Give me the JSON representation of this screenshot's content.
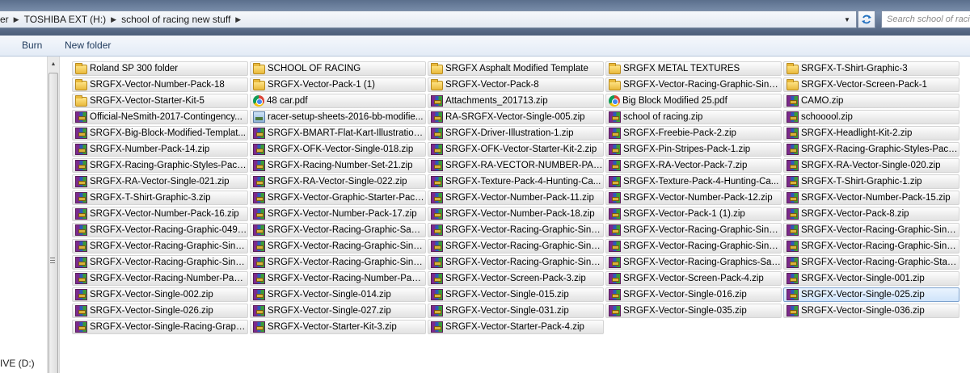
{
  "address_bar": {
    "breadcrumbs": [
      "er",
      "TOSHIBA EXT (H:)",
      "school of racing new stuff"
    ],
    "search_placeholder": "Search school of racing"
  },
  "toolbar": {
    "burn_label": "Burn",
    "new_folder_label": "New folder"
  },
  "navigation_pane": {
    "drive_label": "IVE (D:)"
  },
  "files": [
    {
      "name": "Roland SP 300 folder",
      "icon": "folder-icon"
    },
    {
      "name": "SCHOOL OF RACING",
      "icon": "folder-icon"
    },
    {
      "name": "SRGFX Asphalt Modified Template",
      "icon": "folder-icon"
    },
    {
      "name": "SRGFX METAL TEXTURES",
      "icon": "folder-icon"
    },
    {
      "name": "SRGFX-T-Shirt-Graphic-3",
      "icon": "folder-icon"
    },
    {
      "name": "SRGFX-Vector-Number-Pack-18",
      "icon": "folder-icon"
    },
    {
      "name": "SRGFX-Vector-Pack-1 (1)",
      "icon": "folder-icon"
    },
    {
      "name": "SRGFX-Vector-Pack-8",
      "icon": "folder-icon"
    },
    {
      "name": "SRGFX-Vector-Racing-Graphic-Singl...",
      "icon": "folder-icon"
    },
    {
      "name": "SRGFX-Vector-Screen-Pack-1",
      "icon": "folder-icon"
    },
    {
      "name": "SRGFX-Vector-Starter-Kit-5",
      "icon": "folder-icon"
    },
    {
      "name": "48 car.pdf",
      "icon": "pdf-icon"
    },
    {
      "name": "Attachments_201713.zip",
      "icon": "zip-icon"
    },
    {
      "name": "Big Block Modified 25.pdf",
      "icon": "pdf-icon"
    },
    {
      "name": "CAMO.zip",
      "icon": "zip-icon"
    },
    {
      "name": "Official-NeSmith-2017-Contingency...",
      "icon": "zip-icon"
    },
    {
      "name": "racer-setup-sheets-2016-bb-modifie...",
      "icon": "image-icon"
    },
    {
      "name": "RA-SRGFX-Vector-Single-005.zip",
      "icon": "zip-icon"
    },
    {
      "name": "school of racing.zip",
      "icon": "zip-icon"
    },
    {
      "name": "schooool.zip",
      "icon": "zip-icon"
    },
    {
      "name": "SRGFX-Big-Block-Modified-Templat...",
      "icon": "zip-icon"
    },
    {
      "name": "SRGFX-BMART-Flat-Kart-Illustration...",
      "icon": "zip-icon"
    },
    {
      "name": "SRGFX-Driver-Illustration-1.zip",
      "icon": "zip-icon"
    },
    {
      "name": "SRGFX-Freebie-Pack-2.zip",
      "icon": "zip-icon"
    },
    {
      "name": "SRGFX-Headlight-Kit-2.zip",
      "icon": "zip-icon"
    },
    {
      "name": "SRGFX-Number-Pack-14.zip",
      "icon": "zip-icon"
    },
    {
      "name": "SRGFX-OFK-Vector-Single-018.zip",
      "icon": "zip-icon"
    },
    {
      "name": "SRGFX-OFK-Vector-Starter-Kit-2.zip",
      "icon": "zip-icon"
    },
    {
      "name": "SRGFX-Pin-Stripes-Pack-1.zip",
      "icon": "zip-icon"
    },
    {
      "name": "SRGFX-Racing-Graphic-Styles-Pack-...",
      "icon": "zip-icon"
    },
    {
      "name": "SRGFX-Racing-Graphic-Styles-Pack-...",
      "icon": "zip-icon"
    },
    {
      "name": "SRGFX-Racing-Number-Set-21.zip",
      "icon": "zip-icon"
    },
    {
      "name": "SRGFX-RA-VECTOR-NUMBER-PACK...",
      "icon": "zip-icon"
    },
    {
      "name": "SRGFX-RA-Vector-Pack-7.zip",
      "icon": "zip-icon"
    },
    {
      "name": "SRGFX-RA-Vector-Single-020.zip",
      "icon": "zip-icon"
    },
    {
      "name": "SRGFX-RA-Vector-Single-021.zip",
      "icon": "zip-icon"
    },
    {
      "name": "SRGFX-RA-Vector-Single-022.zip",
      "icon": "zip-icon"
    },
    {
      "name": "SRGFX-Texture-Pack-4-Hunting-Ca...",
      "icon": "zip-icon"
    },
    {
      "name": "SRGFX-Texture-Pack-4-Hunting-Ca...",
      "icon": "zip-icon"
    },
    {
      "name": "SRGFX-T-Shirt-Graphic-1.zip",
      "icon": "zip-icon"
    },
    {
      "name": "SRGFX-T-Shirt-Graphic-3.zip",
      "icon": "zip-icon"
    },
    {
      "name": "SRGFX-Vector-Graphic-Starter-Pack-...",
      "icon": "zip-icon"
    },
    {
      "name": "SRGFX-Vector-Number-Pack-11.zip",
      "icon": "zip-icon"
    },
    {
      "name": "SRGFX-Vector-Number-Pack-12.zip",
      "icon": "zip-icon"
    },
    {
      "name": "SRGFX-Vector-Number-Pack-15.zip",
      "icon": "zip-icon"
    },
    {
      "name": "SRGFX-Vector-Number-Pack-16.zip",
      "icon": "zip-icon"
    },
    {
      "name": "SRGFX-Vector-Number-Pack-17.zip",
      "icon": "zip-icon"
    },
    {
      "name": "SRGFX-Vector-Number-Pack-18.zip",
      "icon": "zip-icon"
    },
    {
      "name": "SRGFX-Vector-Pack-1 (1).zip",
      "icon": "zip-icon"
    },
    {
      "name": "SRGFX-Vector-Pack-8.zip",
      "icon": "zip-icon"
    },
    {
      "name": "SRGFX-Vector-Racing-Graphic-049.zip",
      "icon": "zip-icon"
    },
    {
      "name": "SRGFX-Vector-Racing-Graphic-Sam...",
      "icon": "zip-icon"
    },
    {
      "name": "SRGFX-Vector-Racing-Graphic-Singl...",
      "icon": "zip-icon"
    },
    {
      "name": "SRGFX-Vector-Racing-Graphic-Singl...",
      "icon": "zip-icon"
    },
    {
      "name": "SRGFX-Vector-Racing-Graphic-Singl...",
      "icon": "zip-icon"
    },
    {
      "name": "SRGFX-Vector-Racing-Graphic-Singl...",
      "icon": "zip-icon"
    },
    {
      "name": "SRGFX-Vector-Racing-Graphic-Singl...",
      "icon": "zip-icon"
    },
    {
      "name": "SRGFX-Vector-Racing-Graphic-Singl...",
      "icon": "zip-icon"
    },
    {
      "name": "SRGFX-Vector-Racing-Graphic-Singl...",
      "icon": "zip-icon"
    },
    {
      "name": "SRGFX-Vector-Racing-Graphic-Singl...",
      "icon": "zip-icon"
    },
    {
      "name": "SRGFX-Vector-Racing-Graphic-Singl...",
      "icon": "zip-icon"
    },
    {
      "name": "SRGFX-Vector-Racing-Graphic-Singl...",
      "icon": "zip-icon"
    },
    {
      "name": "SRGFX-Vector-Racing-Graphic-Singl...",
      "icon": "zip-icon"
    },
    {
      "name": "SRGFX-Vector-Racing-Graphics-Sam...",
      "icon": "zip-icon"
    },
    {
      "name": "SRGFX-Vector-Racing-Graphic-Start...",
      "icon": "zip-icon"
    },
    {
      "name": "SRGFX-Vector-Racing-Number-Pack...",
      "icon": "zip-icon"
    },
    {
      "name": "SRGFX-Vector-Racing-Number-Pack...",
      "icon": "zip-icon"
    },
    {
      "name": "SRGFX-Vector-Screen-Pack-3.zip",
      "icon": "zip-icon"
    },
    {
      "name": "SRGFX-Vector-Screen-Pack-4.zip",
      "icon": "zip-icon"
    },
    {
      "name": "SRGFX-Vector-Single-001.zip",
      "icon": "zip-icon"
    },
    {
      "name": "SRGFX-Vector-Single-002.zip",
      "icon": "zip-icon"
    },
    {
      "name": "SRGFX-Vector-Single-014.zip",
      "icon": "zip-icon"
    },
    {
      "name": "SRGFX-Vector-Single-015.zip",
      "icon": "zip-icon"
    },
    {
      "name": "SRGFX-Vector-Single-016.zip",
      "icon": "zip-icon"
    },
    {
      "name": "SRGFX-Vector-Single-025.zip",
      "icon": "zip-icon",
      "selected": true
    },
    {
      "name": "SRGFX-Vector-Single-026.zip",
      "icon": "zip-icon"
    },
    {
      "name": "SRGFX-Vector-Single-027.zip",
      "icon": "zip-icon"
    },
    {
      "name": "SRGFX-Vector-Single-031.zip",
      "icon": "zip-icon"
    },
    {
      "name": "SRGFX-Vector-Single-035.zip",
      "icon": "zip-icon"
    },
    {
      "name": "SRGFX-Vector-Single-036.zip",
      "icon": "zip-icon"
    },
    {
      "name": "SRGFX-Vector-Single-Racing-Graphi...",
      "icon": "zip-icon"
    },
    {
      "name": "SRGFX-Vector-Starter-Kit-3.zip",
      "icon": "zip-icon"
    },
    {
      "name": "SRGFX-Vector-Starter-Pack-4.zip",
      "icon": "zip-icon"
    }
  ]
}
